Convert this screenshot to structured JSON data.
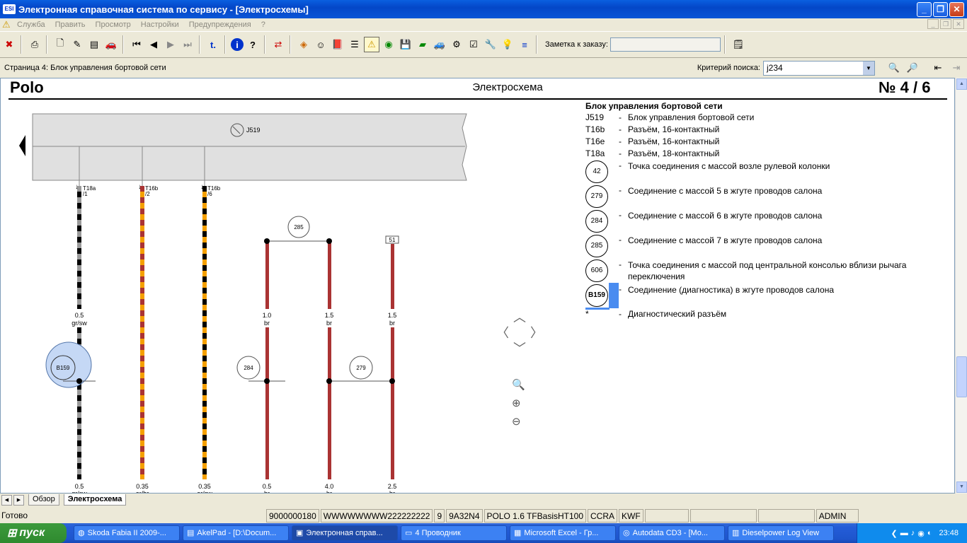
{
  "window": {
    "title": "Электронная справочная система по сервису - [Электросхемы]"
  },
  "menu": [
    "Служба",
    "Править",
    "Просмотр",
    "Настройки",
    "Предупреждения",
    "?"
  ],
  "toolbar": {
    "note_label": "Заметка к заказу:",
    "note_value": ""
  },
  "subbar": {
    "page": "Страница 4: Блок управления бортовой сети",
    "criteria_label": "Критерий поиска:",
    "criteria_value": "j234"
  },
  "sheet": {
    "model": "Polo",
    "title": "Электросхема",
    "number": "№  4 / 6"
  },
  "diagram": {
    "component": "J519",
    "connectors": [
      {
        "name": "T18a",
        "pin": "/1"
      },
      {
        "name": "T16b",
        "pin": "/2"
      },
      {
        "name": "T16b",
        "pin": "/6"
      }
    ],
    "wires": [
      {
        "section": "0.5",
        "color": "gr/sw",
        "section_bottom": "0.5",
        "color_bottom": "gr/sw"
      },
      {
        "section_bottom": "0.35",
        "color_bottom": "or/br"
      },
      {
        "section_bottom": "0.35",
        "color_bottom": "or/sw"
      },
      {
        "section": "1.0",
        "color": "br",
        "section_bottom": "0.5",
        "color_bottom": "br"
      },
      {
        "section": "1.5",
        "color": "br",
        "section_bottom": "4.0",
        "color_bottom": "br"
      },
      {
        "section": "1.5",
        "color": "br",
        "section_bottom": "2.5",
        "color_bottom": "br"
      }
    ],
    "circles": {
      "b159": "B159",
      "c284": "284",
      "c285": "285",
      "c279": "279",
      "box51": "51"
    }
  },
  "legend": {
    "header": "Блок управления бортовой сети",
    "rows": [
      {
        "code": "J519",
        "desc": "Блок управления бортовой сети"
      },
      {
        "code": "T16b",
        "desc": "Разъём, 16-контактный"
      },
      {
        "code": "T16e",
        "desc": "Разъём, 16-контактный"
      },
      {
        "code": "T18a",
        "desc": "Разъём, 18-контактный"
      }
    ],
    "circles": [
      {
        "code": "42",
        "desc": "Точка соединения с массой возле рулевой колонки"
      },
      {
        "code": "279",
        "desc": "Соединение с массой 5 в жгуте проводов салона"
      },
      {
        "code": "284",
        "desc": "Соединение с массой 6 в жгуте проводов салона"
      },
      {
        "code": "285",
        "desc": "Соединение с массой 7 в жгуте проводов салона"
      },
      {
        "code": "606",
        "desc": "Точка соединения с массой под центральной консолью вблизи рычага переключения"
      },
      {
        "code": "B159",
        "desc": "Соединение (диагностика) в жгуте проводов салона"
      }
    ],
    "star": {
      "code": "*",
      "desc": "Диагностический разъём"
    }
  },
  "tabs": [
    "Обзор",
    "Электросхема"
  ],
  "status": {
    "ready": "Готово",
    "cells": [
      "9000000180",
      "WWWWWWWW222222222",
      "9",
      "9A32N4",
      "POLO 1.6 TFBasisHT100",
      "CCRA",
      "KWF",
      "",
      "",
      "",
      "ADMIN"
    ]
  },
  "taskbar": {
    "start": "пуск",
    "tasks": [
      "Skoda Fabia II 2009-...",
      "AkelPad - [D:\\Docum...",
      "Электронная справ...",
      "4 Проводник",
      "Microsoft Excel - Гр...",
      "Autodata CD3 - [Mo...",
      "Dieselpower Log View"
    ],
    "clock": "23:48"
  }
}
